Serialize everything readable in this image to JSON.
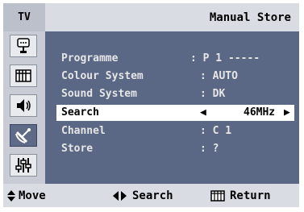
{
  "header": {
    "tab_label": "TV",
    "title": "Manual Store"
  },
  "sidebar": {
    "items": [
      {
        "icon": "input-icon",
        "active": false
      },
      {
        "icon": "picture-icon",
        "active": false
      },
      {
        "icon": "sound-icon",
        "active": false
      },
      {
        "icon": "channel-icon",
        "active": true
      },
      {
        "icon": "setup-icon",
        "active": false
      }
    ]
  },
  "menu": {
    "rows": [
      {
        "label": "Programme",
        "value": ": P 1 -----"
      },
      {
        "label": "Colour System",
        "value": ": AUTO"
      },
      {
        "label": "Sound System",
        "value": ": DK"
      },
      {
        "label": "Search",
        "value": "46MHz"
      },
      {
        "label": "Channel",
        "value": ": C 1"
      },
      {
        "label": "Store",
        "value": ": ?"
      }
    ]
  },
  "footer": {
    "move_label": "Move",
    "search_label": "Search",
    "return_label": "Return"
  },
  "colors": {
    "panel": "#5a6785",
    "frame": "#2f3e5c",
    "bar": "#d9dce3",
    "highlight": "#ffffff"
  }
}
